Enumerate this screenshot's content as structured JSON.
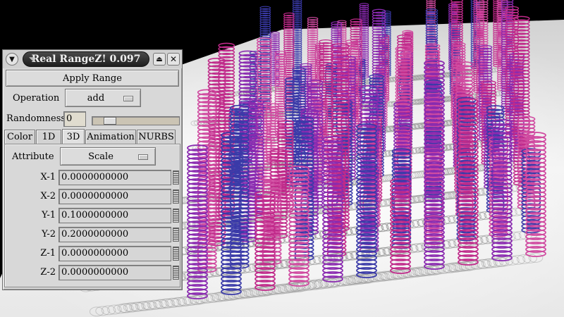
{
  "window": {
    "title": "Real RangeZ! 0.097",
    "menu_icon": "chevron-down-icon",
    "shade_icon": "eject-icon",
    "close_icon": "close-icon",
    "apply_label": "Apply Range",
    "operation_label": "Operation",
    "operation_value": "add",
    "randomness_label": "Randomness",
    "randomness_value": "0",
    "randomness_slider_fraction": 0.15,
    "tabs": [
      "Color",
      "1D",
      "3D",
      "Animation",
      "NURBS"
    ],
    "active_tab": "3D",
    "attribute_label": "Attribute",
    "attribute_value": "Scale",
    "fields": [
      {
        "label": "X-1",
        "value": "0.0000000000"
      },
      {
        "label": "X-2",
        "value": "0.0000000000"
      },
      {
        "label": "Y-1",
        "value": "0.1000000000"
      },
      {
        "label": "Y-2",
        "value": "0.2000000000"
      },
      {
        "label": "Z-1",
        "value": "0.0000000000"
      },
      {
        "label": "Z-2",
        "value": "0.0000000000"
      }
    ]
  },
  "scene": {
    "background_color": "#000000",
    "floor_color": "#e6e6e6",
    "spring_colors": [
      "#c02a8a",
      "#3a3aa8",
      "#8a2ab0",
      "#d04aa0"
    ]
  }
}
